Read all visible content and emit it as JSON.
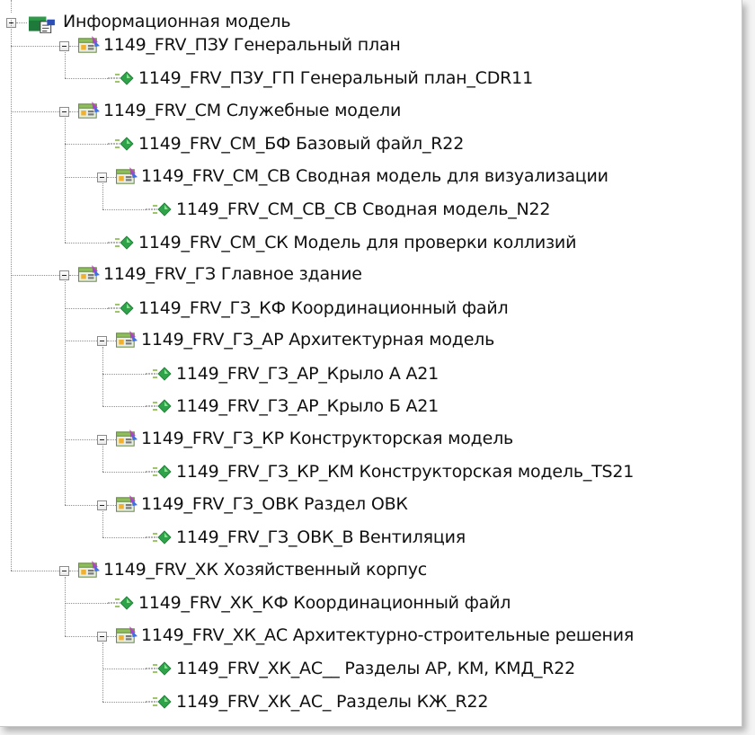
{
  "tree": {
    "root": {
      "label": "Информационная модель",
      "icon": "document-folder-icon"
    },
    "nodes": [
      {
        "label": "1149_FRV_ПЗУ Генеральный план",
        "icon": "model-group-icon"
      },
      {
        "label": "1149_FRV_ПЗУ_ГП  Генеральный план_CDR11",
        "icon": "model-file-icon"
      },
      {
        "label": "1149_FRV_СМ Служебные модели",
        "icon": "model-group-icon"
      },
      {
        "label": "1149_FRV_СМ_БФ  Базовый файл_R22",
        "icon": "model-file-icon"
      },
      {
        "label": "1149_FRV_СМ_СВ Сводная модель для визуализации",
        "icon": "model-group-icon"
      },
      {
        "label": "1149_FRV_СМ_СВ_СВ  Сводная модель_N22",
        "icon": "model-file-icon"
      },
      {
        "label": "1149_FRV_СМ_СК Модель для проверки коллизий",
        "icon": "model-group-icon"
      },
      {
        "label": "1149_FRV_ГЗ Главное здание",
        "icon": "model-group-icon"
      },
      {
        "label": "1149_FRV_ГЗ_КФ  Координационный файл",
        "icon": "model-file-icon"
      },
      {
        "label": "1149_FRV_ГЗ_АР Архитектурная модель",
        "icon": "model-group-icon"
      },
      {
        "label": "1149_FRV_ГЗ_АР_Крыло А  А21",
        "icon": "model-file-icon"
      },
      {
        "label": "1149_FRV_ГЗ_АР_Крыло Б  А21",
        "icon": "model-file-icon"
      },
      {
        "label": "1149_FRV_ГЗ_КР Конструкторская модель",
        "icon": "model-group-icon"
      },
      {
        "label": "1149_FRV_ГЗ_КР_КМ  Конструкторская модель_TS21",
        "icon": "model-file-icon"
      },
      {
        "label": "1149_FRV_ГЗ_ОВК Раздел ОВК",
        "icon": "model-group-icon"
      },
      {
        "label": "1149_FRV_ГЗ_ОВК_В  Вентиляция",
        "icon": "model-file-icon"
      },
      {
        "label": "1149_FRV_ХК Хозяйственный корпус",
        "icon": "model-group-icon"
      },
      {
        "label": "1149_FRV_ХК_КФ  Координационный файл",
        "icon": "model-file-icon"
      },
      {
        "label": "1149_FRV_ХК_АС Архитектурно-строительные решения",
        "icon": "model-group-icon"
      },
      {
        "label": "1149_FRV_ХК_АС__  Разделы АР, КМ, КМД_R22",
        "icon": "model-file-icon"
      },
      {
        "label": "1149_FRV_ХК_АС_  Разделы КЖ_R22",
        "icon": "model-file-icon"
      }
    ]
  }
}
